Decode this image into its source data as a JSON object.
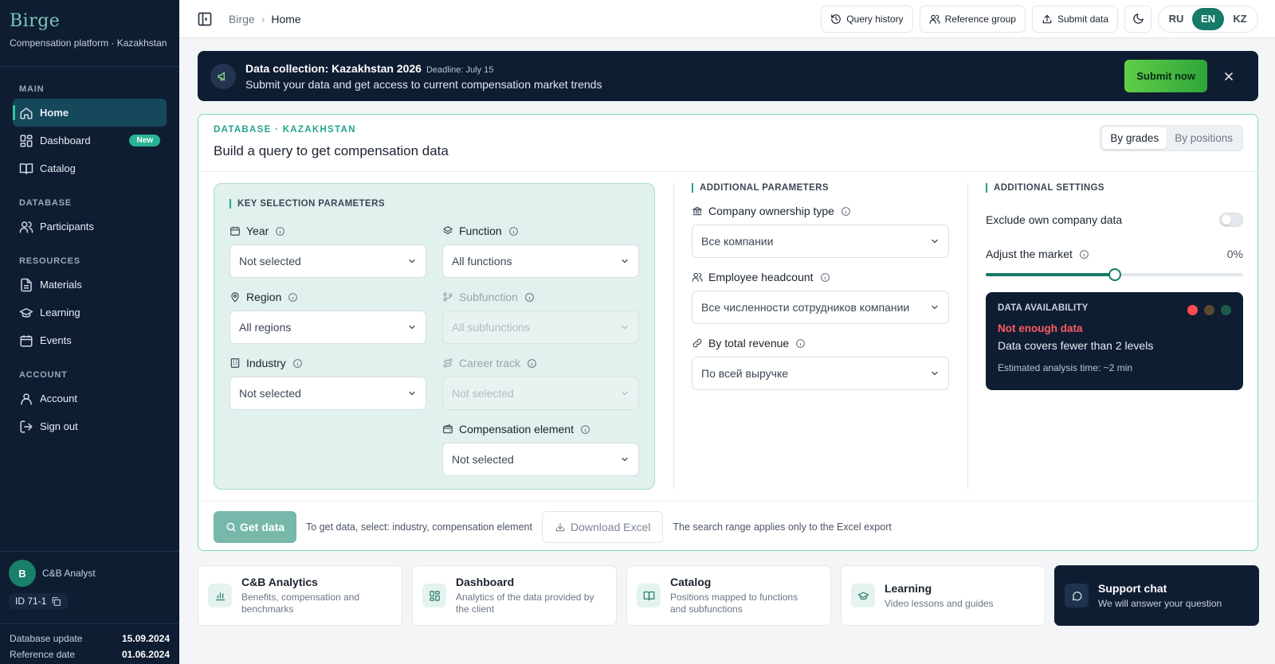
{
  "brand": {
    "logo": "Birge",
    "subtitle": "Compensation platform · Kazakhstan"
  },
  "nav": {
    "sections": [
      {
        "label": "MAIN",
        "items": [
          {
            "label": "Home",
            "icon": "home-icon",
            "active": true
          },
          {
            "label": "Dashboard",
            "icon": "dashboard-icon",
            "badge": "New"
          },
          {
            "label": "Catalog",
            "icon": "book-icon"
          }
        ]
      },
      {
        "label": "DATABASE",
        "items": [
          {
            "label": "Participants",
            "icon": "users-icon"
          }
        ]
      },
      {
        "label": "RESOURCES",
        "items": [
          {
            "label": "Materials",
            "icon": "document-icon"
          },
          {
            "label": "Learning",
            "icon": "graduation-cap-icon"
          },
          {
            "label": "Events",
            "icon": "calendar-icon"
          }
        ]
      },
      {
        "label": "ACCOUNT",
        "items": [
          {
            "label": "Account",
            "icon": "user-icon"
          },
          {
            "label": "Sign out",
            "icon": "sign-out-icon"
          }
        ]
      }
    ]
  },
  "user": {
    "initial": "B",
    "name": "C&B Analyst",
    "id": "ID 71-1"
  },
  "meta": {
    "db_update_label": "Database update",
    "db_update_value": "15.09.2024",
    "ref_date_label": "Reference date",
    "ref_date_value": "01.06.2024"
  },
  "topbar": {
    "breadcrumb_root": "Birge",
    "breadcrumb_sep": "›",
    "breadcrumb_current": "Home",
    "query_history": "Query history",
    "reference_group": "Reference group",
    "submit_data": "Submit data",
    "languages": [
      "RU",
      "EN",
      "KZ"
    ],
    "active_language": "EN"
  },
  "banner": {
    "title": "Data collection: Kazakhstan 2026",
    "deadline": "Deadline: July 15",
    "subtitle": "Submit your data and get access to current compensation market trends",
    "cta": "Submit now"
  },
  "query": {
    "kicker": "DATABASE · KAZAKHSTAN",
    "title": "Build a query to get compensation data",
    "mode_grades": "By grades",
    "mode_positions": "By positions",
    "key_section": "KEY SELECTION PARAMETERS",
    "year_label": "Year",
    "year_value": "Not selected",
    "function_label": "Function",
    "function_value": "All functions",
    "region_label": "Region",
    "region_value": "All regions",
    "subfunction_label": "Subfunction",
    "subfunction_value": "All subfunctions",
    "industry_label": "Industry",
    "industry_value": "Not selected",
    "career_label": "Career track",
    "career_value": "Not selected",
    "comp_label": "Compensation element",
    "comp_value": "Not selected",
    "additional_params": "ADDITIONAL PARAMETERS",
    "ownership_label": "Company ownership type",
    "ownership_value": "Все компании",
    "headcount_label": "Employee headcount",
    "headcount_value": "Все численности сотрудников компании",
    "revenue_label": "By total revenue",
    "revenue_value": "По всей выручке",
    "additional_settings": "ADDITIONAL SETTINGS",
    "exclude_label": "Exclude own company data",
    "adjust_label": "Adjust the market",
    "adjust_value": "0%",
    "adjust_slider_fraction": 0.5,
    "avail_kicker": "DATA AVAILABILITY",
    "avail_status": "Not enough data",
    "avail_desc": "Data covers fewer than 2 levels",
    "avail_time": "Estimated analysis time: ~2 min",
    "get_data": "Get data",
    "get_hint": "To get data, select: industry, compensation element",
    "download_excel": "Download Excel",
    "excel_hint": "The search range applies only to the Excel export"
  },
  "tiles": [
    {
      "title": "C&B Analytics",
      "sub": "Benefits, compensation and benchmarks",
      "icon": "bar-chart-icon"
    },
    {
      "title": "Dashboard",
      "sub": "Analytics of the data provided by the client",
      "icon": "dashboard-icon"
    },
    {
      "title": "Catalog",
      "sub": "Positions mapped to functions and subfunctions",
      "icon": "book-icon"
    },
    {
      "title": "Learning",
      "sub": "Video lessons and guides",
      "icon": "graduation-cap-icon"
    },
    {
      "title": "Support chat",
      "sub": "We will answer your question",
      "icon": "chat-bubble-icon"
    }
  ],
  "colors": {
    "accent": "#157b68",
    "sidebar": "#0f1d33",
    "alert_red": "#ff5a5f",
    "cta_green": "#4dbb41"
  }
}
